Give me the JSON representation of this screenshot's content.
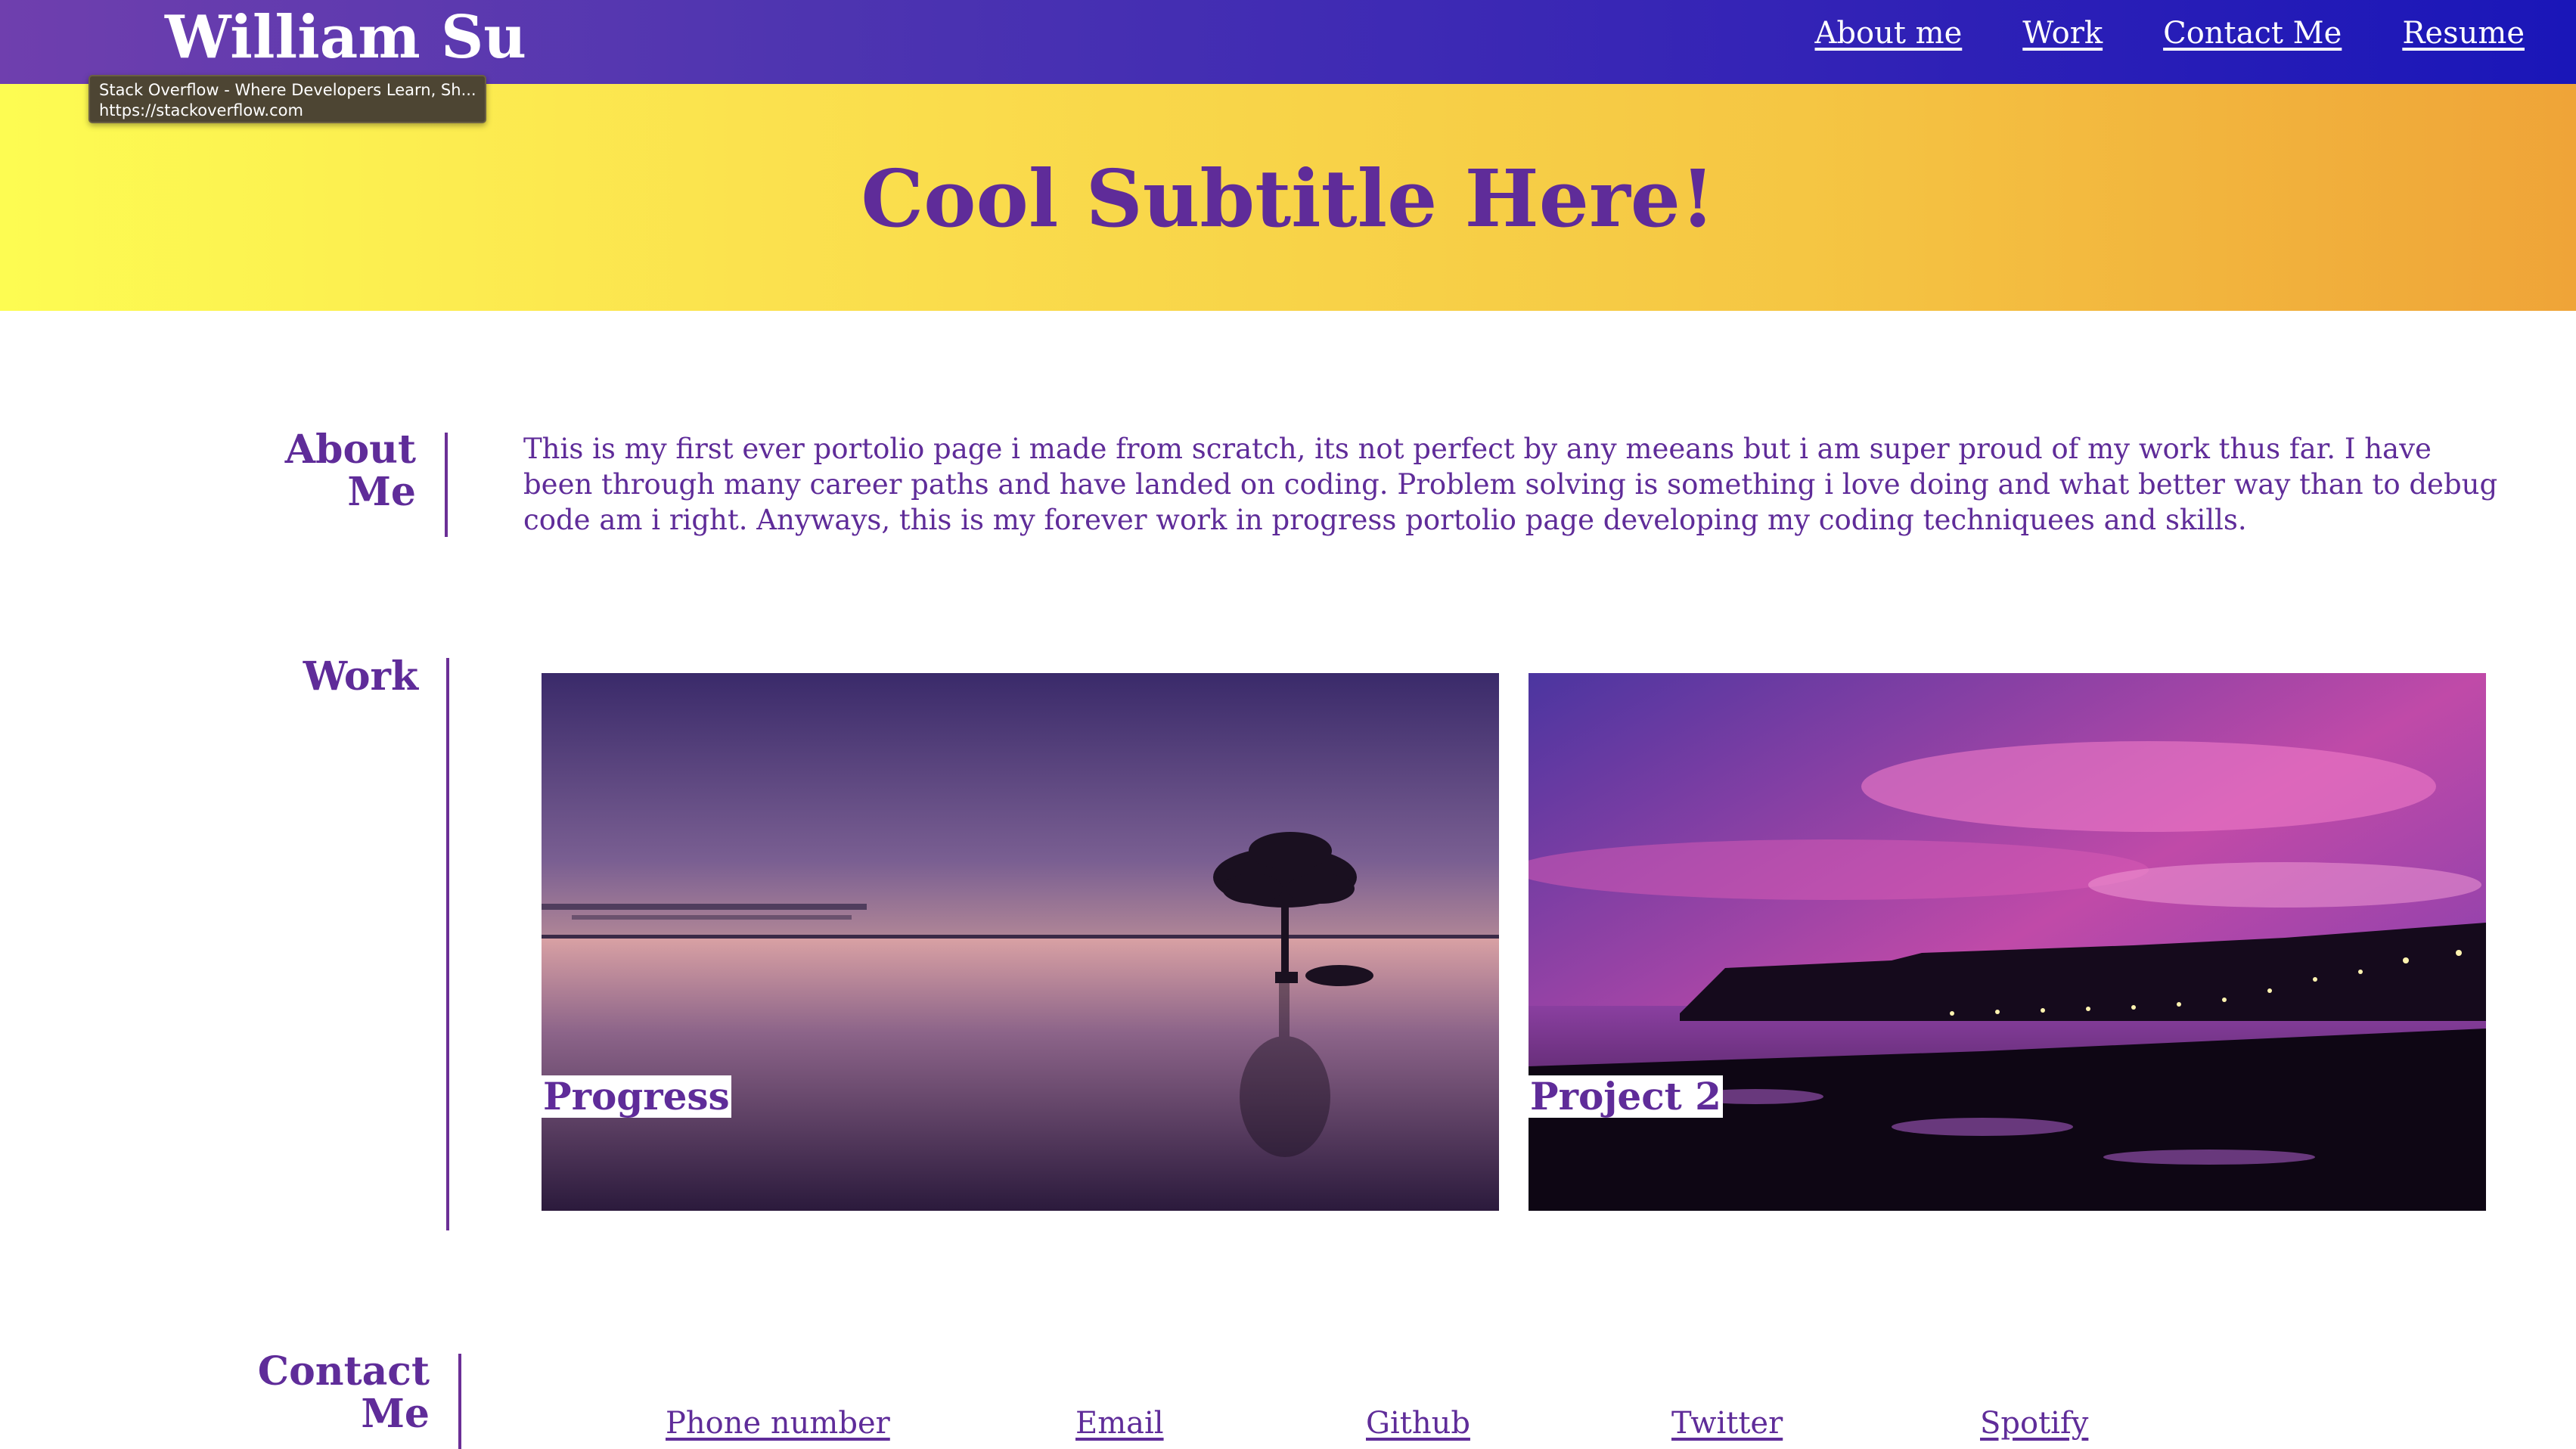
{
  "header": {
    "site_name": "William Su",
    "nav": [
      "About me",
      "Work",
      "Contact Me",
      "Resume"
    ]
  },
  "tooltip": {
    "title": "Stack Overflow - Where Developers Learn, Sh...",
    "url": "https://stackoverflow.com"
  },
  "hero": {
    "title": "Cool Subtitle Here!"
  },
  "about": {
    "heading": "About Me",
    "text": "This is my first ever portolio page i made from scratch, its not perfect by any meeans but i am super proud of my work thus far. I have been through many career paths and have landed on coding. Problem solving is something i love doing and what better way than to debug code am i right. Anyways, this is my forever work in progress portolio page developing my coding techniquees and skills."
  },
  "work": {
    "heading": "Work",
    "projects": [
      {
        "label": "Progress",
        "image": "sunset-lake-tree"
      },
      {
        "label": "Project 2",
        "image": "coastal-night-town"
      }
    ]
  },
  "contact": {
    "heading": "Contact Me",
    "links": [
      "Phone number",
      "Email",
      "Github",
      "Twitter",
      "Spotify"
    ]
  },
  "colors": {
    "header_gradient": [
      "#6f3fae",
      "#1a16b8"
    ],
    "hero_gradient": [
      "#fdfc52",
      "#efa438"
    ],
    "accent_purple": "#5f2c99"
  }
}
